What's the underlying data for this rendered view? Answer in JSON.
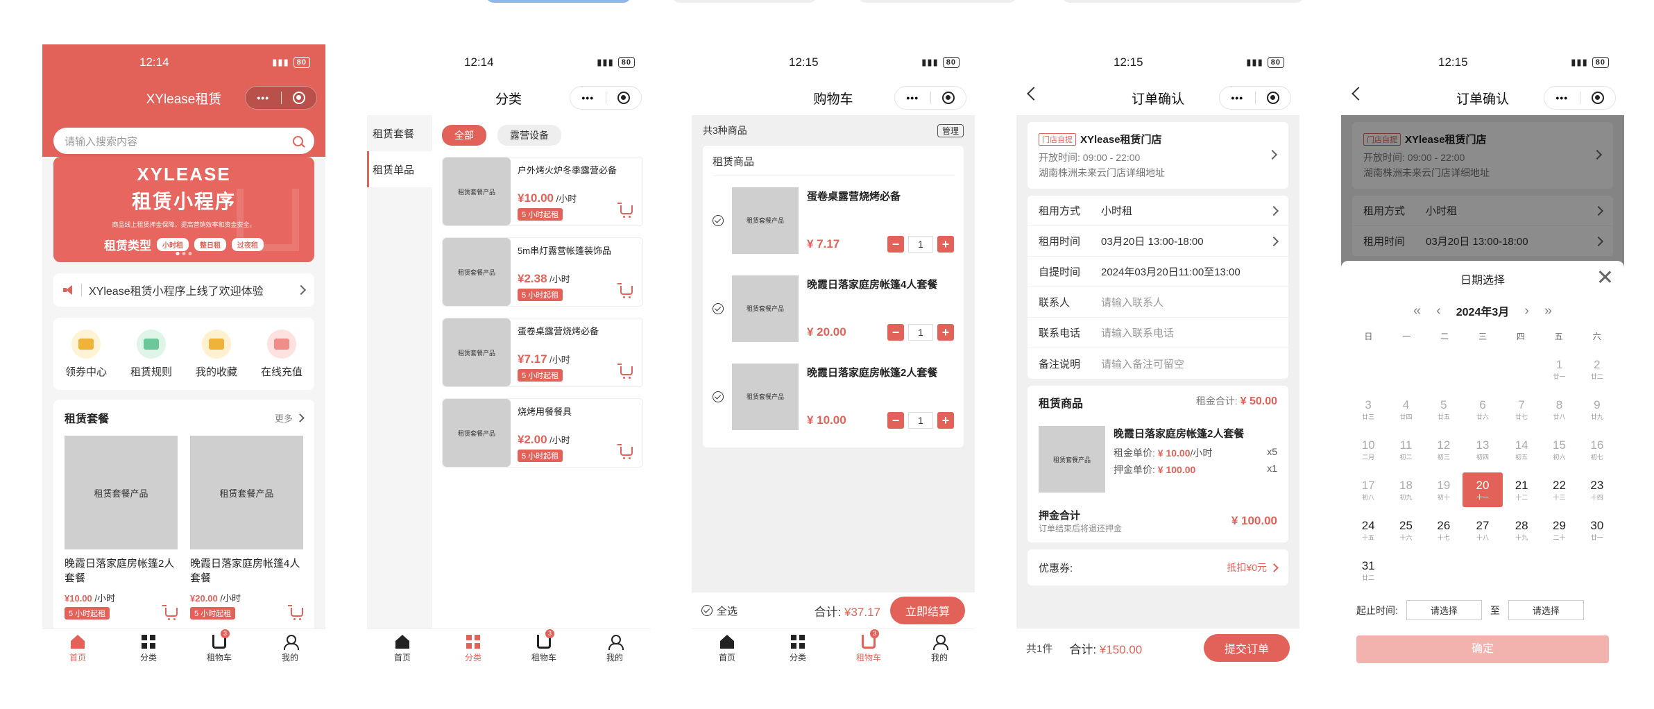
{
  "battery": "80",
  "tabbar": {
    "home": "首页",
    "category": "分类",
    "cart": "租物车",
    "mine": "我的",
    "cart_badge": "3"
  },
  "ph_label": "租赁套餐产品",
  "p1": {
    "time": "12:14",
    "title": "XYlease租赁",
    "search_placeholder": "请输入搜索内容",
    "banner": {
      "brand": "XYLEASE",
      "headline": "租赁小程序",
      "sub": "商品线上租赁押金保障，提高营销效率和资金安全。",
      "type_label": "租赁类型",
      "chips": [
        "小时租",
        "整日租",
        "过夜租"
      ]
    },
    "notice": "XYlease租赁小程序上线了欢迎体验",
    "quick": [
      {
        "label": "领券中心",
        "bg": "#fff3d6",
        "fg": "#f0b33a"
      },
      {
        "label": "租赁规则",
        "bg": "#dff5e8",
        "fg": "#6cc79a"
      },
      {
        "label": "我的收藏",
        "bg": "#fff0d0",
        "fg": "#f0b33a"
      },
      {
        "label": "在线充值",
        "bg": "#ffe2e0",
        "fg": "#ef8e88"
      }
    ],
    "pkg_title": "租赁套餐",
    "more": "更多",
    "cards": [
      {
        "name": "晚霞日落家庭房帐篷2人套餐",
        "price": "¥10.00",
        "unit": "/小时",
        "tag": "5 小时起租"
      },
      {
        "name": "晚霞日落家庭房帐篷4人套餐",
        "price": "¥20.00",
        "unit": "/小时",
        "tag": "5 小时起租"
      }
    ]
  },
  "p2": {
    "time": "12:14",
    "title": "分类",
    "side": [
      "租赁套餐",
      "租赁单品"
    ],
    "chips": [
      "全部",
      "露营设备"
    ],
    "items": [
      {
        "name": "户外烤火炉冬季露营必备",
        "price": "¥10.00",
        "unit": "/小时",
        "tag": "5 小时起租"
      },
      {
        "name": "5m串灯露营帐篷装饰品",
        "price": "¥2.38",
        "unit": "/小时",
        "tag": "5 小时起租"
      },
      {
        "name": "蛋卷桌露营烧烤必备",
        "price": "¥7.17",
        "unit": "/小时",
        "tag": "5 小时起租"
      },
      {
        "name": "烧烤用餐餐具",
        "price": "¥2.00",
        "unit": "/小时",
        "tag": "5 小时起租"
      }
    ]
  },
  "p3": {
    "time": "12:15",
    "title": "购物车",
    "count_text": "共3种商品",
    "manage": "管理",
    "section": "租赁商品",
    "items": [
      {
        "name": "蛋卷桌露营烧烤必备",
        "price": "¥ 7.17",
        "qty": "1"
      },
      {
        "name": "晚霞日落家庭房帐篷4人套餐",
        "price": "¥ 20.00",
        "qty": "1"
      },
      {
        "name": "晚霞日落家庭房帐篷2人套餐",
        "price": "¥ 10.00",
        "qty": "1"
      }
    ],
    "select_all": "全选",
    "total_label": "合计:",
    "total": "¥37.17",
    "checkout": "立即结算"
  },
  "p4": {
    "time": "12:15",
    "title": "订单确认",
    "store": {
      "tag": "门店自提",
      "name": "XYlease租赁门店",
      "hours": "开放时间:  09:00 - 22:00",
      "addr": "湖南株洲未来云门店详细地址"
    },
    "fields": [
      {
        "label": "租用方式",
        "value": "小时租",
        "placeholder": false,
        "arrow": true
      },
      {
        "label": "租用时间",
        "value": "03月20日 13:00-18:00",
        "placeholder": false,
        "arrow": true
      },
      {
        "label": "自提时间",
        "value": "2024年03月20日11:00至13:00",
        "placeholder": false,
        "arrow": false
      },
      {
        "label": "联系人",
        "value": "请输入联系人",
        "placeholder": true,
        "arrow": false
      },
      {
        "label": "联系电话",
        "value": "请输入联系电话",
        "placeholder": true,
        "arrow": false
      },
      {
        "label": "备注说明",
        "value": "请输入备注可留空",
        "placeholder": true,
        "arrow": false
      }
    ],
    "goods_title": "租赁商品",
    "rent_total_label": "租金合计:",
    "rent_total": "¥ 50.00",
    "good": {
      "name": "晚霞日落家庭房帐篷2人套餐",
      "rent_label": "租金单价:",
      "rent": "¥ 10.00",
      "rent_unit": "/小时",
      "rent_qty": "x5",
      "dep_label": "押金单价:",
      "dep": "¥ 100.00",
      "dep_qty": "x1"
    },
    "deposit_title": "押金合计",
    "deposit_sub": "订单结束后将退还押金",
    "deposit_total": "¥ 100.00",
    "coupon_label": "优惠券:",
    "coupon_value": "抵扣¥0元",
    "count": "共1件",
    "total_label": "合计:",
    "total": "¥150.00",
    "submit": "提交订单"
  },
  "p5": {
    "time": "12:15",
    "title": "订单确认",
    "sheet_title": "日期选择",
    "month": "2024年3月",
    "weekdays": [
      "日",
      "一",
      "二",
      "三",
      "四",
      "五",
      "六"
    ],
    "range_label": "起止时间:",
    "range_from": "请选择",
    "range_to_label": "至",
    "range_to": "请选择",
    "confirm": "确定",
    "days": [
      {
        "d": "",
        "l": ""
      },
      {
        "d": "",
        "l": ""
      },
      {
        "d": "",
        "l": ""
      },
      {
        "d": "",
        "l": ""
      },
      {
        "d": "",
        "l": ""
      },
      {
        "d": "1",
        "l": "廿一",
        "past": true
      },
      {
        "d": "2",
        "l": "廿二",
        "past": true
      },
      {
        "d": "3",
        "l": "廿三",
        "past": true
      },
      {
        "d": "4",
        "l": "廿四",
        "past": true
      },
      {
        "d": "5",
        "l": "廿五",
        "past": true
      },
      {
        "d": "6",
        "l": "廿六",
        "past": true
      },
      {
        "d": "7",
        "l": "廿七",
        "past": true
      },
      {
        "d": "8",
        "l": "廿八",
        "past": true
      },
      {
        "d": "9",
        "l": "廿九",
        "past": true
      },
      {
        "d": "10",
        "l": "二月",
        "past": true
      },
      {
        "d": "11",
        "l": "初二",
        "past": true
      },
      {
        "d": "12",
        "l": "初三",
        "past": true
      },
      {
        "d": "13",
        "l": "初四",
        "past": true
      },
      {
        "d": "14",
        "l": "初五",
        "past": true
      },
      {
        "d": "15",
        "l": "初六",
        "past": true
      },
      {
        "d": "16",
        "l": "初七",
        "past": true
      },
      {
        "d": "17",
        "l": "初八",
        "past": true
      },
      {
        "d": "18",
        "l": "初九",
        "past": true
      },
      {
        "d": "19",
        "l": "初十",
        "past": true
      },
      {
        "d": "20",
        "l": "十一",
        "sel": true
      },
      {
        "d": "21",
        "l": "十二"
      },
      {
        "d": "22",
        "l": "十三"
      },
      {
        "d": "23",
        "l": "十四"
      },
      {
        "d": "24",
        "l": "十五"
      },
      {
        "d": "25",
        "l": "十六"
      },
      {
        "d": "26",
        "l": "十七"
      },
      {
        "d": "27",
        "l": "十八"
      },
      {
        "d": "28",
        "l": "十九"
      },
      {
        "d": "29",
        "l": "二十"
      },
      {
        "d": "30",
        "l": "廿一"
      },
      {
        "d": "31",
        "l": "廿二"
      }
    ]
  }
}
